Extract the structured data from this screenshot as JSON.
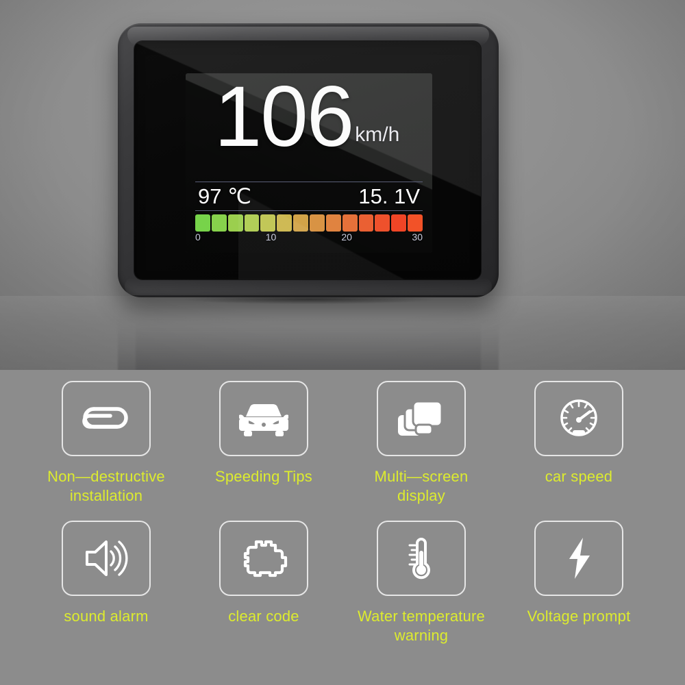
{
  "product_photo": {
    "device_name": "obd-hud-display-unit",
    "screen": {
      "speed_value": "106",
      "speed_unit": "km/h",
      "coolant_temp": "97 ℃",
      "voltage": "15. 1V",
      "gauge": {
        "tick_labels": [
          "0",
          "10",
          "20",
          "30"
        ],
        "tick_positions_pct": [
          0,
          33.3,
          66.6,
          100
        ],
        "segment_count": 14,
        "segment_colors": [
          "#77d34a",
          "#87d24c",
          "#9bcf4e",
          "#aecb4f",
          "#bfc44f",
          "#ccb64c",
          "#d2a348",
          "#d89344",
          "#e08340",
          "#e5713a",
          "#ea6033",
          "#ee512c",
          "#f04526",
          "#f25228"
        ]
      },
      "accent_line_color": "#5b5f78",
      "text_color": "#ffffff",
      "tick_text_color": "#c9ccdd"
    }
  },
  "features": {
    "label_color": "#ddec2e",
    "tile_border_color": "#e6e6e6",
    "panel_background": "#8c8c8c",
    "rows": [
      [
        {
          "icon": "paperclip-icon",
          "label": "Non—destructive\ninstallation"
        },
        {
          "icon": "car-front-icon",
          "label": "Speeding Tips"
        },
        {
          "icon": "multi-screen-icon",
          "label": "Multi—screen display"
        },
        {
          "icon": "speedometer-icon",
          "label": "car speed"
        }
      ],
      [
        {
          "icon": "speaker-sound-icon",
          "label": "sound alarm"
        },
        {
          "icon": "check-engine-icon",
          "label": "clear code"
        },
        {
          "icon": "thermometer-icon",
          "label": "Water temperature\nwarning"
        },
        {
          "icon": "lightning-bolt-icon",
          "label": "Voltage prompt"
        }
      ]
    ]
  }
}
